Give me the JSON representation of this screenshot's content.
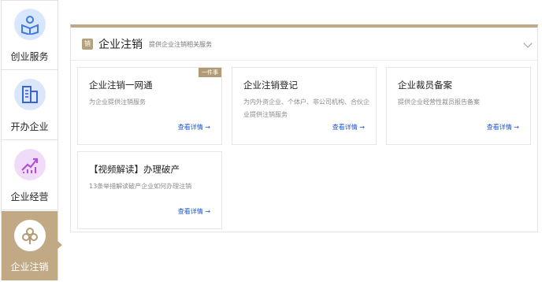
{
  "sidebar": {
    "items": [
      {
        "label": "创业服务",
        "icon": "reading-person-icon"
      },
      {
        "label": "开办企业",
        "icon": "building-icon"
      },
      {
        "label": "企业经营",
        "icon": "growth-chart-icon"
      },
      {
        "label": "企业注销",
        "icon": "flower-icon",
        "active": true
      }
    ]
  },
  "panel": {
    "badge": "销",
    "title": "企业注销",
    "subtitle": "提供企业注销相关服务",
    "cards": [
      {
        "title": "企业注销一网通",
        "desc": "为企业提供注销服务",
        "link": "查看详情 →",
        "tag": "一件事"
      },
      {
        "title": "企业注销登记",
        "desc": "为内外资企业、个体户、非公司机构、合伙企业提供注销服务",
        "link": "查看详情 →"
      },
      {
        "title": "企业裁员备案",
        "desc": "提供企业经营性裁员报告备案",
        "link": "查看详情 →"
      },
      {
        "title": "【视频解读】办理破产",
        "desc": "13条举措解读破产企业如何办理注销",
        "link": "查看详情 →"
      }
    ]
  },
  "colors": {
    "accent": "#c1a985",
    "link": "#1a56d6"
  }
}
